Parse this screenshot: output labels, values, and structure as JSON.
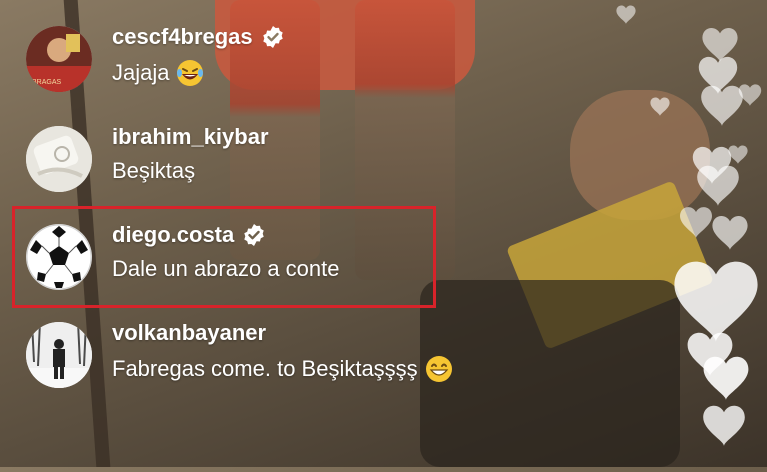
{
  "comments": [
    {
      "username": "cescf4bregas",
      "verified": true,
      "text": "Jajaja",
      "emoji": "laughing-tears-emoji"
    },
    {
      "username": "ibrahim_kiybar",
      "verified": false,
      "text": "Beşiktaş"
    },
    {
      "username": "diego.costa",
      "verified": true,
      "text": "Dale un abrazo a conte",
      "highlighted": true
    },
    {
      "username": "volkanbayaner",
      "verified": false,
      "text": "Fabregas come. to Beşiktaşşşş",
      "emoji": "grinning-emoji"
    }
  ],
  "colors": {
    "highlight_border": "#d8232a",
    "text": "#ffffff",
    "heart": "#ffffff"
  }
}
